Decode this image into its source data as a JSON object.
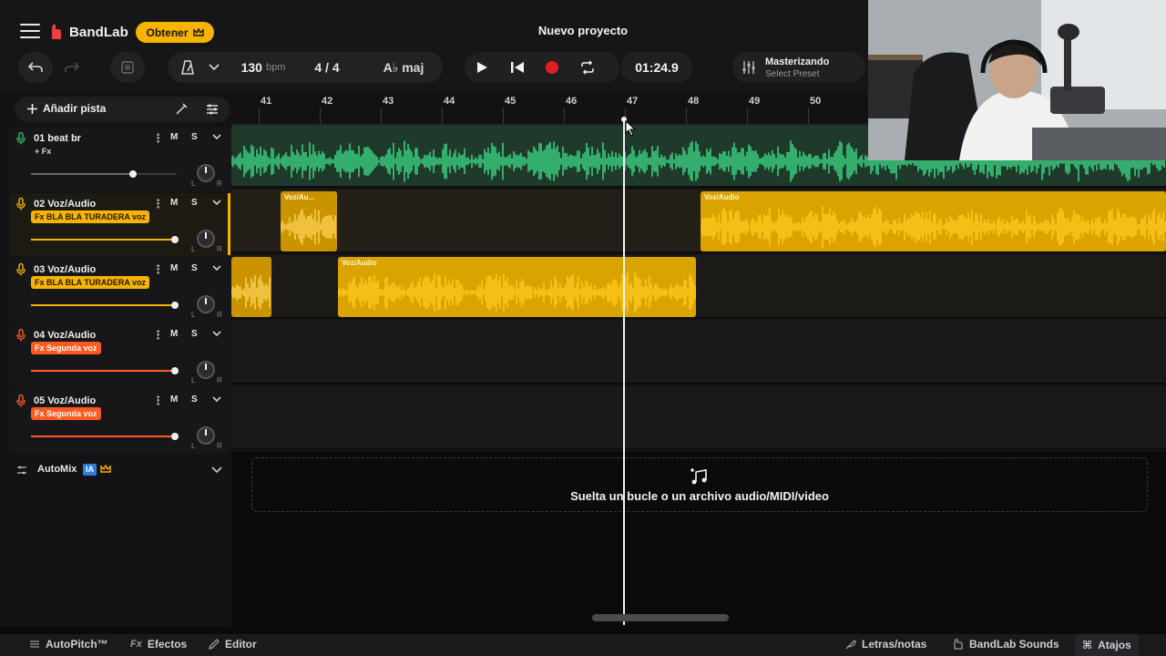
{
  "header": {
    "logo_text": "BandLab",
    "obtener_label": "Obtener",
    "project_title": "Nuevo proyecto",
    "bpm": "130",
    "bpm_unit": "bpm",
    "time_signature": "4 / 4",
    "key": "A♭ maj",
    "time_display": "01:24.9",
    "mastering_title": "Masterizando",
    "mastering_sub": "Select Preset"
  },
  "left": {
    "add_track_label": "Añadir pista",
    "automix_label": "AutoMix",
    "automix_badge": "IA"
  },
  "tracks": [
    {
      "name": "01  beat br",
      "fx": "+ Fx",
      "fx_style": "plain",
      "mute": "M",
      "solo": "S",
      "volume": 0.7,
      "color": "#2fbf71",
      "pan_left": "L",
      "pan_right": "R"
    },
    {
      "name": "02  Voz/Audio",
      "fx": "Fx BLA BLA TURADERA voz",
      "fx_style": "yellow",
      "mute": "M",
      "solo": "S",
      "volume": 0.99,
      "color": "#f4b400",
      "pan_left": "L",
      "pan_right": "R"
    },
    {
      "name": "03  Voz/Audio",
      "fx": "Fx BLA BLA TURADERA voz",
      "fx_style": "yellow",
      "mute": "M",
      "solo": "S",
      "volume": 0.99,
      "color": "#f4b400",
      "pan_left": "L",
      "pan_right": "R"
    },
    {
      "name": "04  Voz/Audio",
      "fx": "Fx Segunda voz",
      "fx_style": "orange",
      "mute": "M",
      "solo": "S",
      "volume": 0.99,
      "color": "#ff5a1f",
      "pan_left": "L",
      "pan_right": "R"
    },
    {
      "name": "05  Voz/Audio",
      "fx": "Fx Segunda voz",
      "fx_style": "orange",
      "mute": "M",
      "solo": "S",
      "volume": 0.99,
      "color": "#ff5a1f",
      "pan_left": "L",
      "pan_right": "R"
    }
  ],
  "ruler": {
    "bars": [
      "41",
      "42",
      "43",
      "44",
      "45",
      "46",
      "47",
      "48",
      "49",
      "50"
    ]
  },
  "clips": {
    "t2a_label": "Voz/Au...",
    "t2b_label": "Voz/Audio",
    "t3b_label": "Voz/Audio"
  },
  "dropzone_text": "Suelta un bucle o un archivo audio/MIDI/video",
  "bottom": {
    "autopitch": "AutoPitch™",
    "efectos": "Efectos",
    "editor": "Editor",
    "letras": "Letras/notas",
    "sounds": "BandLab Sounds",
    "atajos": "Atajos"
  },
  "colors": {
    "accent_yellow": "#f4b400",
    "accent_green": "#2fbf71",
    "accent_orange": "#ff5a1f",
    "record_red": "#e02020"
  },
  "icons": [
    "menu-icon",
    "bandlab-logo-icon",
    "crown-icon",
    "undo-icon",
    "redo-icon",
    "snap-icon",
    "metronome-icon",
    "chevron-down-icon",
    "play-icon",
    "skip-back-icon",
    "record-icon",
    "loop-icon",
    "mastering-icon",
    "plus-icon",
    "wand-icon",
    "mixer-icon",
    "mic-icon",
    "music-note-icon",
    "pencil-icon",
    "keyboard-icon"
  ]
}
